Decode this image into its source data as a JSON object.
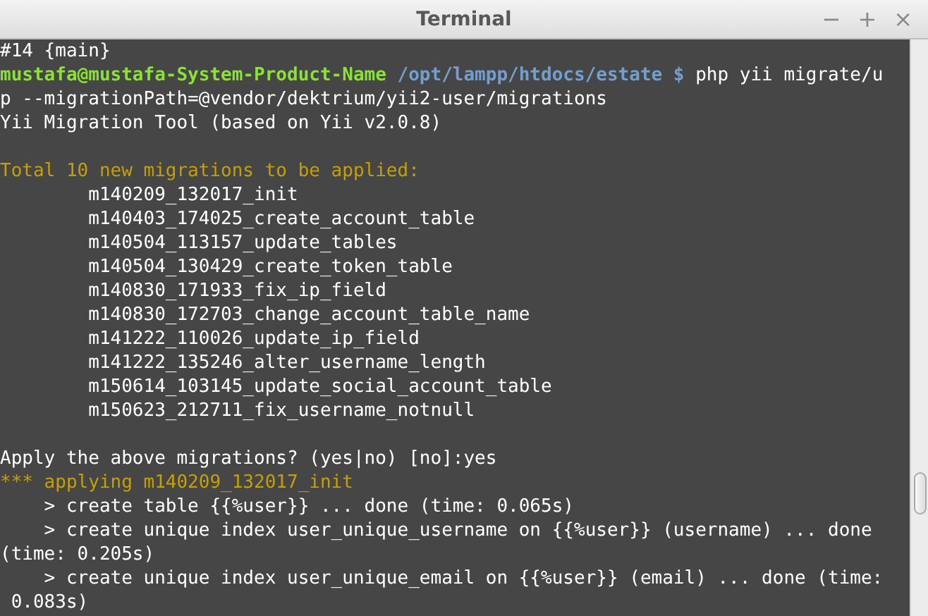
{
  "window": {
    "title": "Terminal",
    "controls": [
      "−",
      "+",
      "×"
    ]
  },
  "terminal": {
    "lines": [
      {
        "kind": "text",
        "segments": [
          {
            "kind": "plain",
            "text": "#14 {main}"
          }
        ]
      },
      {
        "kind": "text",
        "segments": [
          {
            "kind": "user",
            "text": "mustafa@mustafa-System-Product-Name"
          },
          {
            "kind": "path",
            "text": " /opt/lampp/htdocs/estate $"
          },
          {
            "kind": "plain",
            "text": " php yii migrate/u"
          }
        ]
      },
      {
        "kind": "text",
        "segments": [
          {
            "kind": "plain",
            "text": "p --migrationPath=@vendor/dektrium/yii2-user/migrations"
          }
        ]
      },
      {
        "kind": "text",
        "segments": [
          {
            "kind": "plain",
            "text": "Yii Migration Tool (based on Yii v2.0.8)"
          }
        ]
      },
      {
        "kind": "blank"
      },
      {
        "kind": "text",
        "segments": [
          {
            "kind": "warn",
            "text": "Total 10 new migrations to be applied:"
          }
        ]
      },
      {
        "kind": "text",
        "segments": [
          {
            "kind": "plain",
            "text": "        m140209_132017_init"
          }
        ]
      },
      {
        "kind": "text",
        "segments": [
          {
            "kind": "plain",
            "text": "        m140403_174025_create_account_table"
          }
        ]
      },
      {
        "kind": "text",
        "segments": [
          {
            "kind": "plain",
            "text": "        m140504_113157_update_tables"
          }
        ]
      },
      {
        "kind": "text",
        "segments": [
          {
            "kind": "plain",
            "text": "        m140504_130429_create_token_table"
          }
        ]
      },
      {
        "kind": "text",
        "segments": [
          {
            "kind": "plain",
            "text": "        m140830_171933_fix_ip_field"
          }
        ]
      },
      {
        "kind": "text",
        "segments": [
          {
            "kind": "plain",
            "text": "        m140830_172703_change_account_table_name"
          }
        ]
      },
      {
        "kind": "text",
        "segments": [
          {
            "kind": "plain",
            "text": "        m141222_110026_update_ip_field"
          }
        ]
      },
      {
        "kind": "text",
        "segments": [
          {
            "kind": "plain",
            "text": "        m141222_135246_alter_username_length"
          }
        ]
      },
      {
        "kind": "text",
        "segments": [
          {
            "kind": "plain",
            "text": "        m150614_103145_update_social_account_table"
          }
        ]
      },
      {
        "kind": "text",
        "segments": [
          {
            "kind": "plain",
            "text": "        m150623_212711_fix_username_notnull"
          }
        ]
      },
      {
        "kind": "blank"
      },
      {
        "kind": "text",
        "segments": [
          {
            "kind": "plain",
            "text": "Apply the above migrations? (yes|no) [no]:yes"
          }
        ]
      },
      {
        "kind": "text",
        "segments": [
          {
            "kind": "warn",
            "text": "*** applying m140209_132017_init"
          }
        ]
      },
      {
        "kind": "text",
        "segments": [
          {
            "kind": "plain",
            "text": "    > create table {{%user}} ... done (time: 0.065s)"
          }
        ]
      },
      {
        "kind": "text",
        "segments": [
          {
            "kind": "plain",
            "text": "    > create unique index user_unique_username on {{%user}} (username) ... done"
          }
        ]
      },
      {
        "kind": "text",
        "segments": [
          {
            "kind": "plain",
            "text": "(time: 0.205s)"
          }
        ]
      },
      {
        "kind": "text",
        "segments": [
          {
            "kind": "plain",
            "text": "    > create unique index user_unique_email on {{%user}} (email) ... done (time:"
          }
        ]
      },
      {
        "kind": "text",
        "segments": [
          {
            "kind": "plain",
            "text": " 0.083s)"
          }
        ]
      }
    ]
  }
}
